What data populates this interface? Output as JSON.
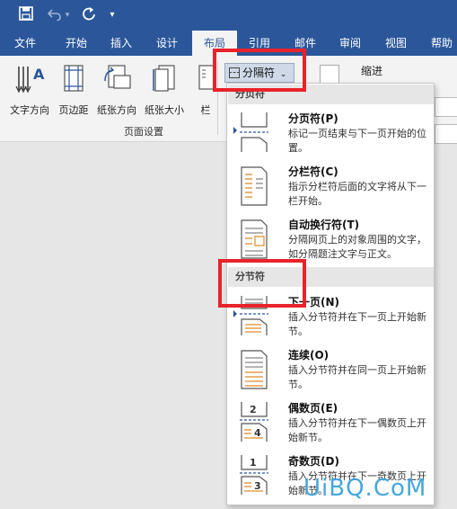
{
  "quick_access": {
    "save": "save-icon",
    "undo": "undo-icon",
    "redo": "redo-icon",
    "customize": "▾"
  },
  "tabs": [
    "文件",
    "开始",
    "插入",
    "设计",
    "布局",
    "引用",
    "邮件",
    "审阅",
    "视图",
    "帮助"
  ],
  "active_tab": "布局",
  "ribbon": {
    "buttons": [
      "文字方向",
      "页边距",
      "纸张方向",
      "纸张大小",
      "栏"
    ],
    "group_label": "页面设置",
    "breaks_label": "分隔符",
    "indent_label": "缩进"
  },
  "dropdown": {
    "page_breaks_header": "分页符",
    "section_breaks_header": "分节符",
    "page_items": [
      {
        "name": "分页符(P)",
        "desc": "标记一页结束与下一页开始的位置。"
      },
      {
        "name": "分栏符(C)",
        "desc": "指示分栏符后面的文字将从下一栏开始。"
      },
      {
        "name": "自动换行符(T)",
        "desc": "分隔网页上的对象周围的文字，如分隔题注文字与正文。"
      }
    ],
    "section_items": [
      {
        "name": "下一页(N)",
        "desc": "插入分节符并在下一页上开始新节。"
      },
      {
        "name": "连续(O)",
        "desc": "插入分节符并在同一页上开始新节。"
      },
      {
        "name": "偶数页(E)",
        "desc": "插入分节符并在下一偶数页上开始新节。"
      },
      {
        "name": "奇数页(D)",
        "desc": "插入分节符并在下一奇数页上开始新节。"
      }
    ]
  },
  "highlight_color": "#e8232b",
  "accent_color": "#2b579a",
  "watermark": "UiBQ.CoM"
}
